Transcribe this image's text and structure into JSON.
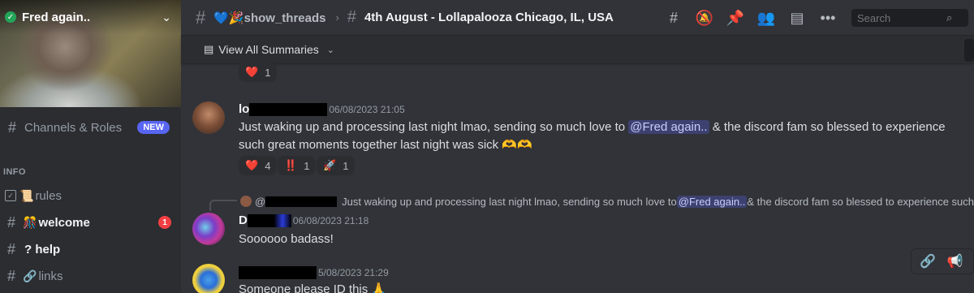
{
  "server": {
    "name": "Fred again..",
    "verified": "✓"
  },
  "sidebar": {
    "channels_roles": {
      "label": "Channels & Roles",
      "badge": "NEW"
    },
    "category": "INFO",
    "channels": [
      {
        "emoji": "📜",
        "name": "rules",
        "icon": "rules-icon"
      },
      {
        "emoji": "🎊",
        "name": "welcome",
        "icon": "hash-icon",
        "mentions": "1"
      },
      {
        "emoji": "",
        "name": "? help",
        "icon": "hash-icon"
      },
      {
        "emoji": "🔗",
        "name": "links",
        "icon": "hash-icon"
      }
    ]
  },
  "topbar": {
    "parent_channel": "💙🎉show_threads",
    "separator": "›",
    "thread_title": "4th August - Lollapalooza Chicago, IL, USA",
    "search_placeholder": "Search"
  },
  "summaries": {
    "label": "View All Summaries"
  },
  "messages": [
    {
      "reactions": [
        {
          "emoji": "❤️",
          "count": "1"
        }
      ]
    },
    {
      "author_prefix": "lo",
      "timestamp": "06/08/2023 21:05",
      "text_before": "Just waking up and processing last night lmao, sending so much love to ",
      "mention": "@Fred again..",
      "text_after": " & the discord fam so blessed to experience such great moments together last night was sick 🫶🫶",
      "reactions": [
        {
          "emoji": "❤️",
          "count": "4"
        },
        {
          "emoji": "‼️",
          "count": "1"
        },
        {
          "emoji": "🚀",
          "count": "1"
        }
      ]
    },
    {
      "reply": {
        "author_prefix": "@",
        "text_before": "Just waking up and processing last night lmao, sending so much love to ",
        "mention": "@Fred again..",
        "text_after": " & the discord fam so blessed to experience such"
      },
      "author_prefix": "D",
      "timestamp": "06/08/2023 21:18",
      "text": "Soooooo badass!"
    },
    {
      "author_prefix": "",
      "timestamp": "5/08/2023 21:29",
      "text": "Someone please ID this 🙏"
    }
  ],
  "colors": {
    "background": "#313338",
    "sidebar": "#2b2d31",
    "accent": "#5865f2",
    "danger": "#f23f43",
    "online": "#23a55a"
  }
}
